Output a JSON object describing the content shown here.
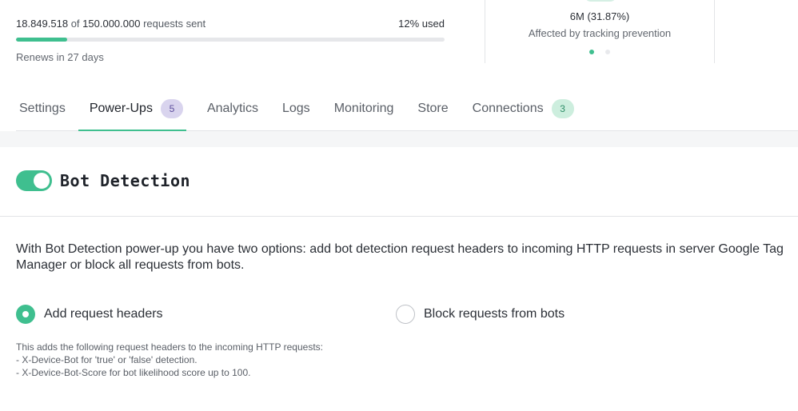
{
  "usage": {
    "sent": "18.849.518",
    "of": "of",
    "total": "150.000.000",
    "suffix": "requests sent",
    "used_label": "12% used",
    "progress_fraction": 0.12,
    "renews": "Renews in 27 days"
  },
  "stat": {
    "value": "6M (31.87%)",
    "label": "Affected by tracking prevention"
  },
  "tabs": [
    {
      "label": "Settings"
    },
    {
      "label": "Power-Ups",
      "badge": "5"
    },
    {
      "label": "Analytics"
    },
    {
      "label": "Logs"
    },
    {
      "label": "Monitoring"
    },
    {
      "label": "Store"
    },
    {
      "label": "Connections",
      "badge": "3"
    }
  ],
  "powerup": {
    "title": "Bot Detection",
    "enabled": true,
    "description": "With Bot Detection power-up you have two options: add bot detection request headers to incoming HTTP requests in server Google Tag Manager or block all requests from bots.",
    "options": [
      {
        "label": "Add request headers",
        "selected": true
      },
      {
        "label": "Block requests from bots",
        "selected": false
      }
    ],
    "help": [
      "This adds the following request headers to the incoming HTTP requests:",
      "- X-Device-Bot for 'true' or 'false' detection.",
      "- X-Device-Bot-Score for bot likelihood score up to 100."
    ]
  },
  "colors": {
    "accent": "#3fbf8f",
    "badge_purple": "#d9d4ee",
    "badge_green": "#cdeede"
  }
}
